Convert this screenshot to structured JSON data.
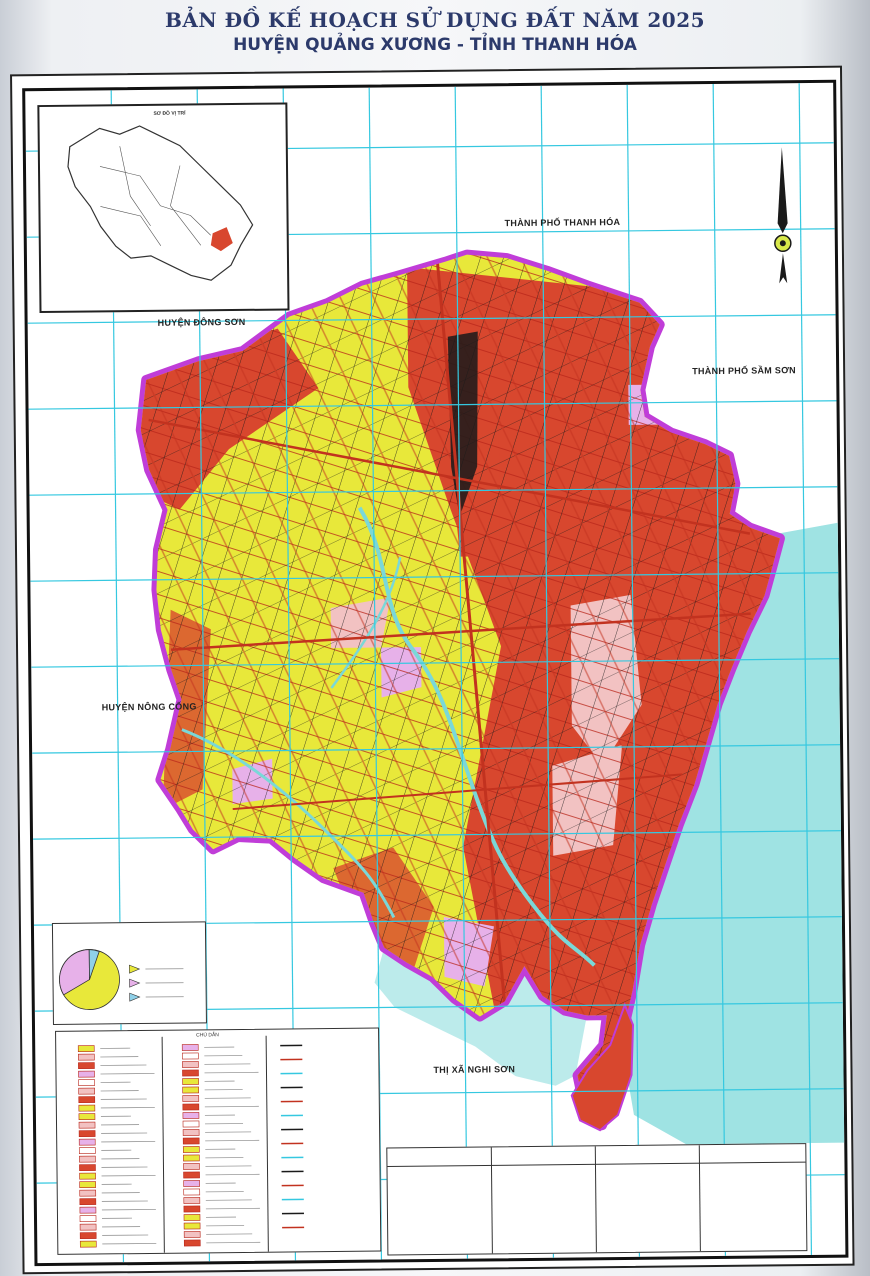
{
  "title": {
    "main": "BẢN ĐỒ KẾ HOẠCH SỬ DỤNG ĐẤT NĂM 2025",
    "sub": "HUYỆN QUẢNG XƯƠNG - TỈNH THANH HÓA"
  },
  "neighbors": {
    "north": "THÀNH PHỐ THANH HÓA",
    "northwest": "HUYỆN ĐÔNG SƠN",
    "east": "THÀNH PHỐ SẦM SƠN",
    "west": "HUYỆN NÔNG CỐNG",
    "south": "THỊ XÃ NGHI SƠN"
  },
  "inset_map": {
    "title": "SƠ ĐỒ VỊ TRÍ"
  },
  "legend": {
    "title": "CHÚ DẪN"
  },
  "colors": {
    "grid": "#35c8e0",
    "boundary": "#c03dd8",
    "agricultural": "#e8e83a",
    "residential": "#d8472e",
    "roads": "#1a1a1a",
    "water": "#7ad8d8",
    "sea": "#9fe3e3",
    "public_land": "#f2c2c2",
    "pink_land": "#e7b1e9"
  },
  "icons": [
    "north-arrow-icon",
    "compass-rose-icon"
  ]
}
